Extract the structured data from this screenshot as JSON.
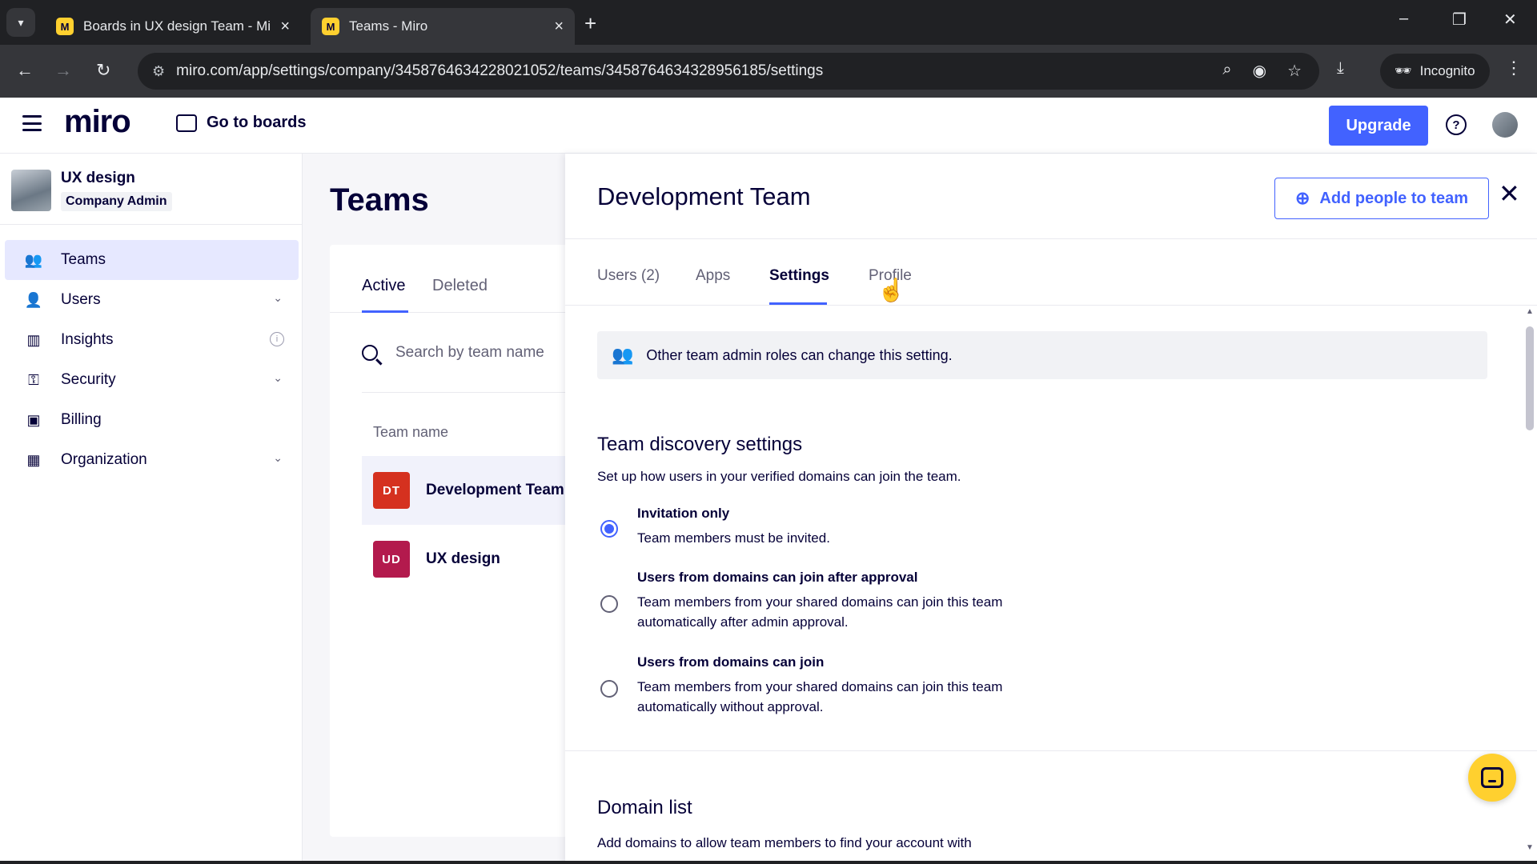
{
  "browser": {
    "tabs": [
      {
        "title": "Boards in UX design Team - Mi",
        "favicon": "M",
        "active": false
      },
      {
        "title": "Teams - Miro",
        "favicon": "M",
        "active": true
      }
    ],
    "url": "miro.com/app/settings/company/3458764634228021052/teams/3458764634328956185/settings",
    "incognito_label": "Incognito"
  },
  "header": {
    "logo": "miro",
    "go_to_boards": "Go to boards",
    "upgrade": "Upgrade",
    "help": "?"
  },
  "sidebar": {
    "org_name": "UX design",
    "org_role": "Company Admin",
    "items": [
      {
        "label": "Teams",
        "icon": "users-icon",
        "active": true
      },
      {
        "label": "Users",
        "icon": "user-icon",
        "chevron": true
      },
      {
        "label": "Insights",
        "icon": "bar-chart-icon",
        "info": true
      },
      {
        "label": "Security",
        "icon": "key-icon",
        "chevron": true
      },
      {
        "label": "Billing",
        "icon": "wallet-icon"
      },
      {
        "label": "Organization",
        "icon": "building-icon",
        "chevron": true
      }
    ]
  },
  "teams_list": {
    "title": "Teams",
    "tabs": [
      "Active",
      "Deleted"
    ],
    "search_placeholder": "Search by team name",
    "column_header": "Team name",
    "rows": [
      {
        "initials": "DT",
        "name": "Development Team",
        "color": "#d5311f",
        "selected": true
      },
      {
        "initials": "UD",
        "name": "UX design",
        "color": "#b31a4d",
        "selected": false
      }
    ]
  },
  "panel": {
    "title": "Development Team",
    "add_people": "Add people to team",
    "tabs": [
      "Users (2)",
      "Apps",
      "Settings",
      "Profile"
    ],
    "active_tab": "Settings",
    "banner": "Other team admin roles can change this setting.",
    "discovery": {
      "title": "Team discovery settings",
      "description": "Set up how users in your verified domains can join the team.",
      "options": [
        {
          "label": "Invitation only",
          "desc": "Team members must be invited.",
          "checked": true
        },
        {
          "label": "Users from domains can join after approval",
          "desc": "Team members from your shared domains can join this team automatically after admin approval.",
          "checked": false
        },
        {
          "label": "Users from domains can join",
          "desc": "Team members from your shared domains can join this team automatically without approval.",
          "checked": false
        }
      ]
    },
    "domain_list": {
      "title": "Domain list",
      "description": "Add domains to allow team members to find your account with"
    }
  },
  "colors": {
    "accent": "#4262ff",
    "ink": "#050038",
    "chat_button": "#ffd02f"
  }
}
